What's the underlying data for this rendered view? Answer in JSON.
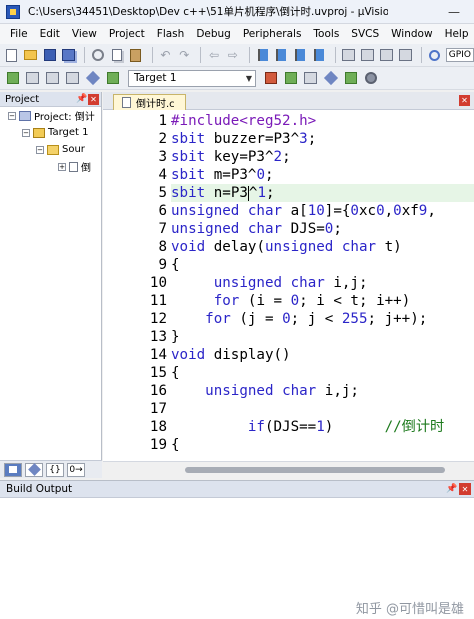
{
  "window": {
    "title": "C:\\Users\\34451\\Desktop\\Dev c++\\51单片机程序\\倒计时.uvproj - µVision"
  },
  "menu": [
    "File",
    "Edit",
    "View",
    "Project",
    "Flash",
    "Debug",
    "Peripherals",
    "Tools",
    "SVCS",
    "Window",
    "Help"
  ],
  "toolbar": {
    "target_label": "Target 1",
    "gpio_label": "GPIO"
  },
  "project": {
    "panel_title": "Project",
    "tree": {
      "root": "Project: 倒计",
      "target": "Target 1",
      "group": "Sour",
      "file": "倒"
    },
    "bottom_tab_fn": "{}",
    "bottom_tab_tpl": "0→"
  },
  "editor": {
    "tab_title": "倒计时.c",
    "lines": [
      {
        "n": "1",
        "code": "#include<reg52.h>"
      },
      {
        "n": "2",
        "code": "sbit buzzer=P3^3;"
      },
      {
        "n": "3",
        "code": "sbit key=P3^2;"
      },
      {
        "n": "4",
        "code": "sbit m=P3^0;"
      },
      {
        "n": "5",
        "code": "sbit n=P3^1;"
      },
      {
        "n": "6",
        "code": "unsigned char a[10]={0xc0,0xf9,"
      },
      {
        "n": "7",
        "code": "unsigned char DJS=0;"
      },
      {
        "n": "8",
        "code": "void delay(unsigned char t)"
      },
      {
        "n": "9",
        "code": "{"
      },
      {
        "n": "10",
        "code": "     unsigned char i,j;"
      },
      {
        "n": "11",
        "code": "     for (i = 0; i < t; i++)"
      },
      {
        "n": "12",
        "code": "    for (j = 0; j < 255; j++);"
      },
      {
        "n": "13",
        "code": "}"
      },
      {
        "n": "14",
        "code": "void display()"
      },
      {
        "n": "15",
        "code": "{"
      },
      {
        "n": "16",
        "code": "    unsigned char i,j;"
      },
      {
        "n": "17",
        "code": ""
      },
      {
        "n": "18",
        "code": "         if(DJS==1)      //倒计时"
      },
      {
        "n": "19",
        "code": "{"
      }
    ],
    "current_line": "5"
  },
  "build_output": {
    "title": "Build Output"
  },
  "watermark": "知乎 @可惜叫是雄"
}
